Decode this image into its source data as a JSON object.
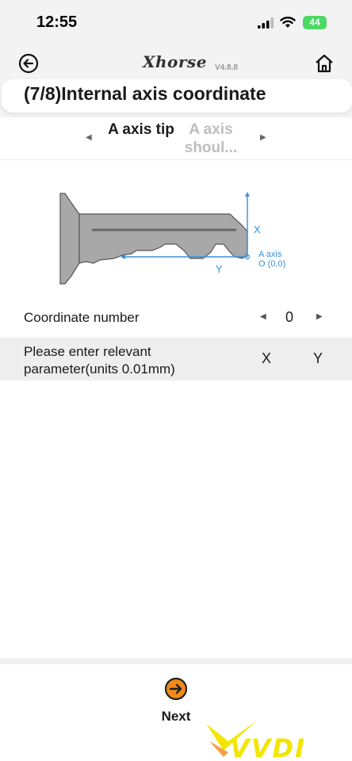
{
  "status_bar": {
    "time": "12:55",
    "battery": "44"
  },
  "nav": {
    "logo": "Xhorse",
    "version": "V4.8.8",
    "back_icon": "back-circle-icon",
    "home_icon": "home-icon"
  },
  "title": "(7/8)Internal axis coordinate",
  "tabs": [
    {
      "label": "A axis tip",
      "active": true
    },
    {
      "label": "A axis shoul...",
      "active": false
    }
  ],
  "diagram": {
    "x_label": "X",
    "y_label": "Y",
    "origin_label_1": "A axis",
    "origin_label_2": "O (0,0)"
  },
  "coordinate": {
    "label": "Coordinate number",
    "value": "0"
  },
  "params": {
    "label": "Please enter relevant parameter(units 0.01mm)",
    "col_x": "X",
    "col_y": "Y"
  },
  "footer": {
    "next_label": "Next",
    "next_icon": "arrow-right-circle-icon"
  },
  "watermark": {
    "text": "VVDI"
  },
  "colors": {
    "accent": "#f08a1c",
    "axis_blue": "#3a8fd9",
    "key_gray": "#a8a8a8"
  }
}
